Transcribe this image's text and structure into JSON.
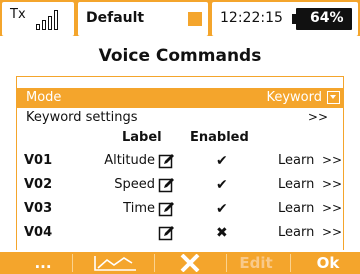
{
  "status_bar": {
    "tx_label": "Tx",
    "profile": "Default",
    "clock": "12:22:15",
    "battery_percent": "64%",
    "signal_icon": "signal-bars-icon",
    "battery_icon": "battery-icon"
  },
  "title": "Voice Commands",
  "mode": {
    "label": "Mode",
    "value": "Keyword"
  },
  "keyword_settings": {
    "label": "Keyword settings",
    "arrow": ">>"
  },
  "columns": {
    "label": "Label",
    "enabled": "Enabled"
  },
  "commands": [
    {
      "id": "V01",
      "label": "Altitude",
      "enabled": "✔",
      "learn": "Learn",
      "arrow": ">>"
    },
    {
      "id": "V02",
      "label": "Speed",
      "enabled": "✔",
      "learn": "Learn",
      "arrow": ">>"
    },
    {
      "id": "V03",
      "label": "Time",
      "enabled": "✔",
      "learn": "Learn",
      "arrow": ">>"
    },
    {
      "id": "V04",
      "label": "",
      "enabled": "✖",
      "learn": "Learn",
      "arrow": ">>"
    }
  ],
  "bottom_bar": {
    "more": "...",
    "graph_icon": "graph-icon",
    "delete_icon": "delete-icon",
    "edit": "Edit",
    "ok": "Ok"
  },
  "colors": {
    "accent": "#f4a52c",
    "text": "#111111",
    "background": "#ffffff"
  }
}
